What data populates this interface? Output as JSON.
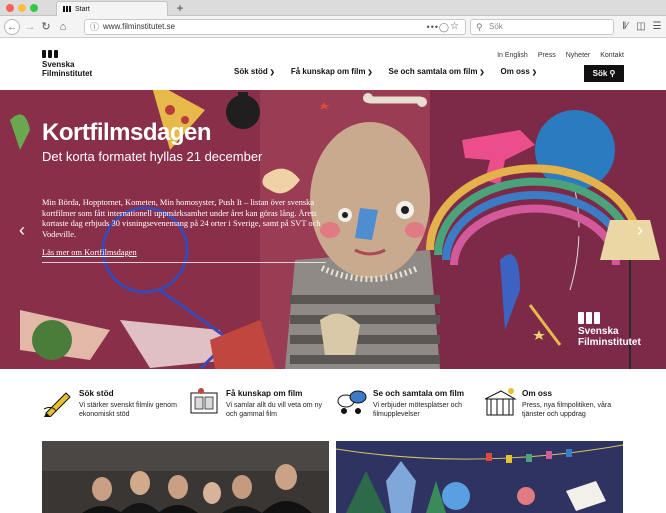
{
  "browser": {
    "tab_title": "Start",
    "new_tab": "+",
    "url": "www.filminstitutet.se",
    "search_placeholder": "Sök",
    "icons": [
      "back-icon",
      "forward-icon",
      "refresh-icon",
      "home-icon",
      "info-icon",
      "more-icon",
      "shield-icon",
      "bookmark-star-icon",
      "search-icon",
      "library-icon",
      "sidebar-icon",
      "menu-icon"
    ]
  },
  "site": {
    "logo_line1": "Svenska",
    "logo_line2": "Filminstitutet",
    "top_links": [
      "In English",
      "Press",
      "Nyheter",
      "Kontakt"
    ],
    "nav": [
      "Sök stöd",
      "Få kunskap om film",
      "Se och samtala om film",
      "Om oss"
    ],
    "search_button": "Sök"
  },
  "hero": {
    "title": "Kortfilmsdagen",
    "subtitle": "Det korta formatet hyllas 21 december",
    "text": "Min Börda, Hopptornet, Kometen, Min homosyster, Push It – listan över svenska kortfilmer som fått internationell uppmärksamhet under året kan göras lång. Årets kortaste dag erbjuds 30 visningsevenemang på 24 orter i Sverige, samt på SVT och Vodeville.",
    "link": "Läs mer om Kortfilmsdagen",
    "prev": "‹",
    "next": "›",
    "logo_line1": "Svenska",
    "logo_line2": "Filminstitutet"
  },
  "features": [
    {
      "title": "Sök stöd",
      "desc": "Vi stärker svenskt filmliv genom ekonomiskt stöd",
      "icon": "pen-icon"
    },
    {
      "title": "Få kunskap om film",
      "desc": "Vi samlar allt du vill veta om ny och gammal film",
      "icon": "film-strip-icon"
    },
    {
      "title": "Se och samtala om film",
      "desc": "Vi erbjuder mötesplatser och filmupplevelser",
      "icon": "discussion-icon"
    },
    {
      "title": "Om oss",
      "desc": "Press, nya filmpolitiken, våra tjänster och uppdrag",
      "icon": "building-icon"
    }
  ],
  "colors": {
    "hero_bg": "#9a3c54",
    "nav_text": "#111111",
    "search_button_bg": "#111111"
  }
}
